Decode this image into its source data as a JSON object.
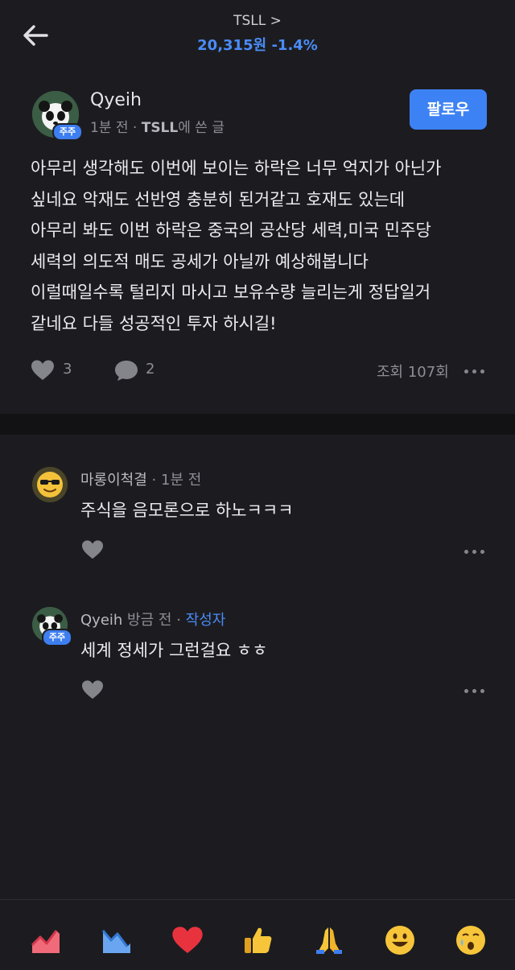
{
  "header": {
    "ticker": "TSLL",
    "chevron": ">",
    "price": "20,315원",
    "change": "-1.4%",
    "accent_color": "#4a8cf7"
  },
  "post": {
    "author": "Qyeih",
    "badge": "주주",
    "time": "1분 전",
    "separator": "·",
    "ticker": "TSLL",
    "suffix": "에 쓴 글",
    "follow_label": "팔로우",
    "body_lines": [
      "아무리 생각해도 이번에 보이는 하락은 너무 억지가 아닌가",
      "싶네요 악재도 선반영 충분히 된거같고 호재도 있는데",
      "아무리 봐도 이번 하락은 중국의 공산당 세력,미국 민주당",
      "세력의 의도적 매도 공세가 아닐까 예상해봅니다",
      "이럴때일수록 털리지 마시고 보유수량 늘리는게 정답일거",
      "같네요 다들 성공적인 투자 하시길!"
    ],
    "likes": "3",
    "comments": "2",
    "views": "조회 107회"
  },
  "comments": [
    {
      "name": "마롱이척결",
      "separator": "·",
      "time": "1분 전",
      "text": "주식을 음모론으로 하노ㅋㅋㅋ"
    },
    {
      "name": "Qyeih",
      "time": "방금 전",
      "separator": "·",
      "author_tag": "작성자",
      "badge": "주주",
      "text": "세계 정세가 그런걸요 ㅎㅎ"
    }
  ],
  "reactions": [
    "chart-up-icon",
    "chart-down-icon",
    "heart-icon",
    "thumbs-up-icon",
    "praying-hands-icon",
    "smile-icon",
    "crying-face-icon"
  ]
}
